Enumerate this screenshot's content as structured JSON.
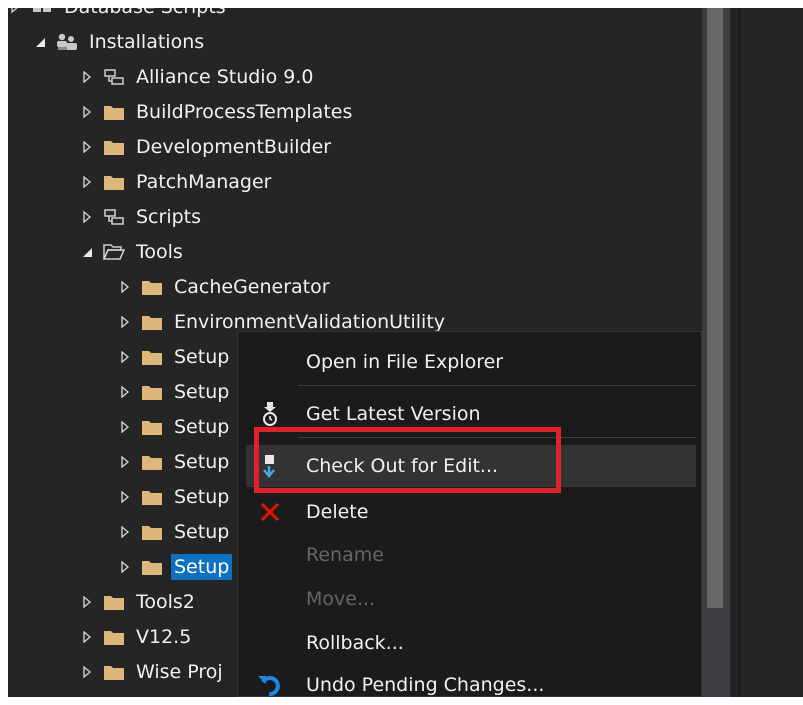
{
  "tree": {
    "rows": [
      {
        "label": "Database Scripts",
        "expanded": false
      },
      {
        "label": "Installations",
        "expanded": true
      },
      {
        "label": "Alliance Studio 9.0",
        "expanded": false
      },
      {
        "label": "BuildProcessTemplates",
        "expanded": false
      },
      {
        "label": "DevelopmentBuilder",
        "expanded": false
      },
      {
        "label": "PatchManager",
        "expanded": false
      },
      {
        "label": "Scripts",
        "expanded": false
      },
      {
        "label": "Tools",
        "expanded": true
      },
      {
        "label": "CacheGenerator",
        "expanded": false
      },
      {
        "label": "EnvironmentValidationUtility",
        "expanded": false
      },
      {
        "label": "Setup",
        "expanded": false
      },
      {
        "label": "Setup",
        "expanded": false
      },
      {
        "label": "Setup",
        "expanded": false
      },
      {
        "label": "Setup",
        "expanded": false
      },
      {
        "label": "Setup",
        "expanded": false
      },
      {
        "label": "Setup",
        "expanded": false
      },
      {
        "label": "Setup",
        "expanded": false,
        "selected": true
      },
      {
        "label": "Tools2",
        "expanded": false
      },
      {
        "label": "V12.5",
        "expanded": false
      },
      {
        "label": "Wise Proj",
        "expanded": false
      }
    ]
  },
  "context_menu": {
    "items": [
      {
        "label": "Open in File Explorer",
        "icon": "none",
        "enabled": true
      },
      {
        "label": "Get Latest Version",
        "icon": "get-latest-icon",
        "enabled": true
      },
      {
        "label": "Check Out for Edit...",
        "icon": "checkout-icon",
        "enabled": true,
        "highlighted": true
      },
      {
        "label": "Delete",
        "icon": "delete-x-icon",
        "enabled": true
      },
      {
        "label": "Rename",
        "icon": "none",
        "enabled": false
      },
      {
        "label": "Move...",
        "icon": "none",
        "enabled": false
      },
      {
        "label": "Rollback...",
        "icon": "none",
        "enabled": true
      },
      {
        "label": "Undo Pending Changes...",
        "icon": "undo-icon",
        "enabled": true
      }
    ]
  },
  "colors": {
    "background": "#252526",
    "text": "#f1f1f1",
    "folder": "#dcb67a",
    "selection": "#0e70c0",
    "menu_bg": "#1b1b1c",
    "disabled_text": "#656565",
    "highlight_box": "#e0202c",
    "delete_red": "#e51400",
    "undo_blue": "#1e88e5"
  }
}
